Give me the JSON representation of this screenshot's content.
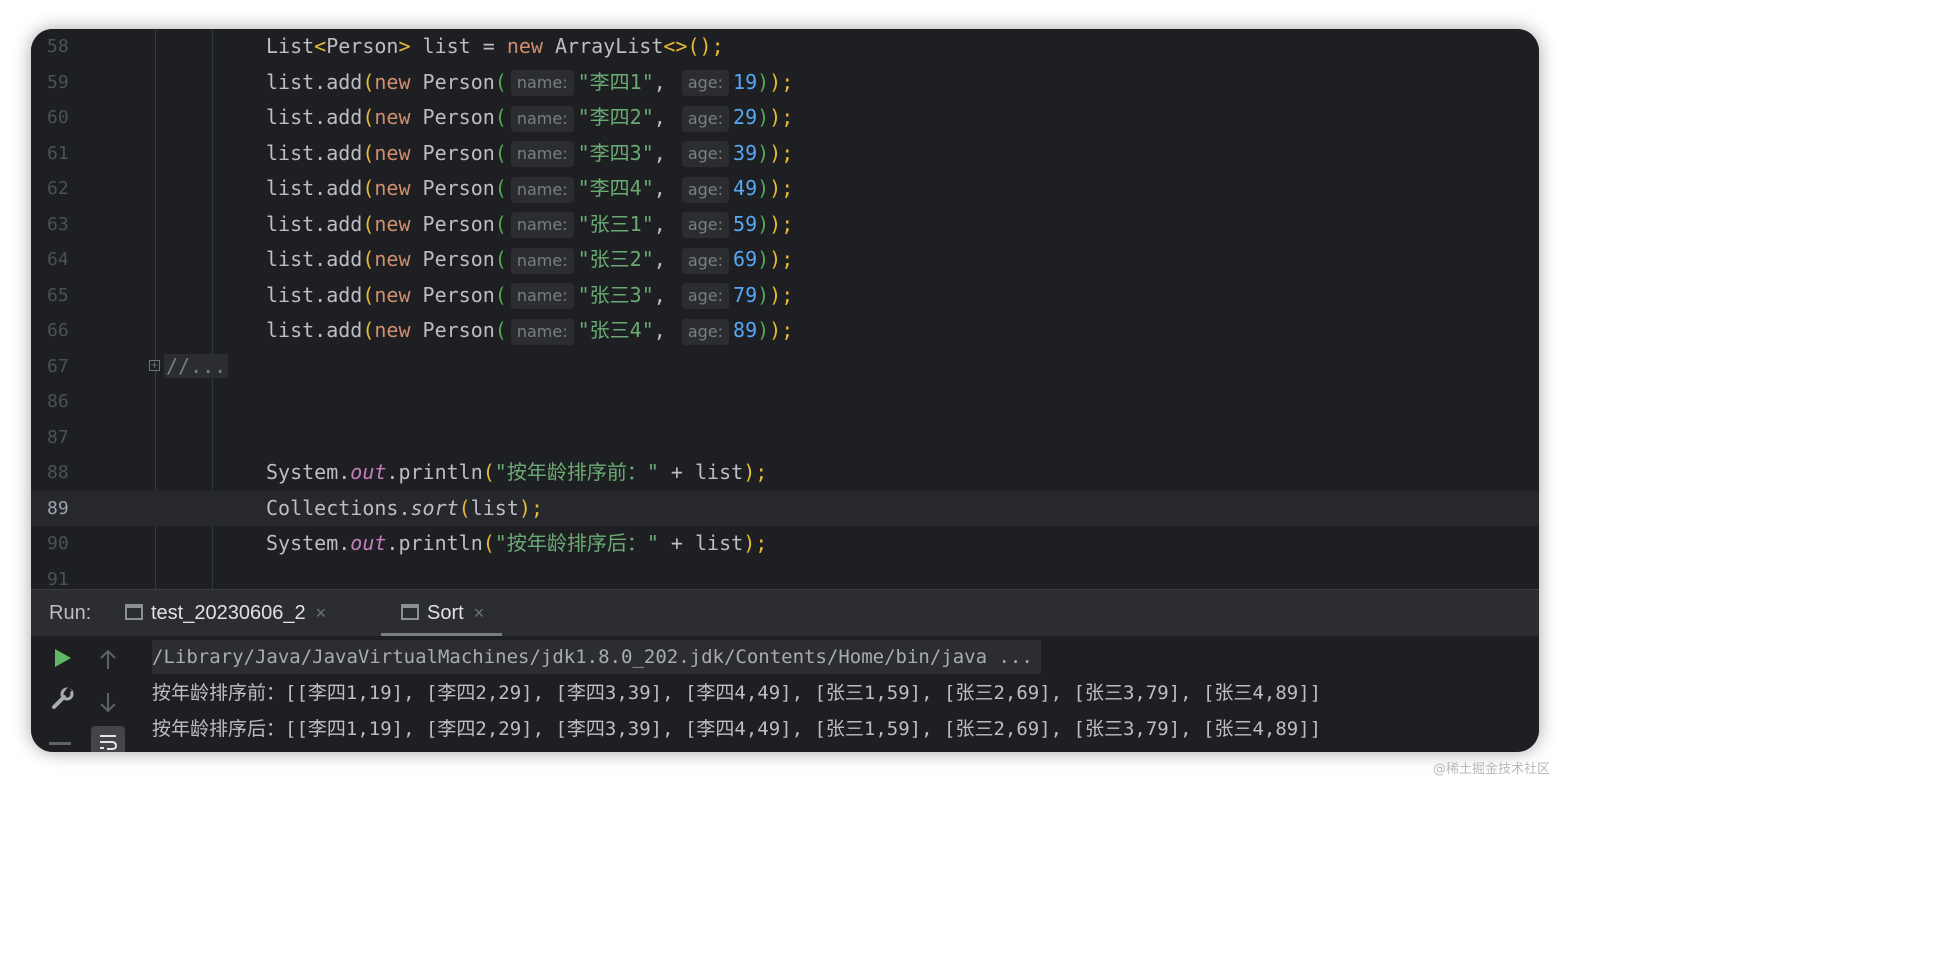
{
  "editor": {
    "lines": [
      {
        "n": "58",
        "segments": [
          [
            "List",
            "t"
          ],
          [
            "<",
            "p"
          ],
          [
            "Person",
            "t"
          ],
          [
            ">",
            "p"
          ],
          [
            " list = ",
            "t"
          ],
          [
            "new",
            "k"
          ],
          [
            " ArrayList",
            "t"
          ],
          [
            "<>",
            "p"
          ],
          [
            "()",
            "p"
          ],
          [
            ";",
            "p"
          ]
        ]
      },
      {
        "n": "59",
        "person": {
          "name": "\"李四1\"",
          "age": "19"
        }
      },
      {
        "n": "60",
        "person": {
          "name": "\"李四2\"",
          "age": "29"
        }
      },
      {
        "n": "61",
        "person": {
          "name": "\"李四3\"",
          "age": "39"
        }
      },
      {
        "n": "62",
        "person": {
          "name": "\"李四4\"",
          "age": "49"
        }
      },
      {
        "n": "63",
        "person": {
          "name": "\"张三1\"",
          "age": "59"
        }
      },
      {
        "n": "64",
        "person": {
          "name": "\"张三2\"",
          "age": "69"
        }
      },
      {
        "n": "65",
        "person": {
          "name": "\"张三3\"",
          "age": "79"
        }
      },
      {
        "n": "66",
        "person": {
          "name": "\"张三4\"",
          "age": "89"
        }
      },
      {
        "n": "67",
        "folded": "//..."
      },
      {
        "n": "86"
      },
      {
        "n": "87"
      },
      {
        "n": "88",
        "println": {
          "obj": "System",
          "field": "out",
          "method": ".println",
          "str": "\"按年龄排序前：\"",
          "rest": " + list"
        }
      },
      {
        "n": "89",
        "sort": {
          "cls": "Collections",
          "method": "sort",
          "arg": "list"
        },
        "current": true
      },
      {
        "n": "90",
        "println": {
          "obj": "System",
          "field": "out",
          "method": ".println",
          "str": "\"按年龄排序后：\"",
          "rest": " + list"
        }
      },
      {
        "n": "91"
      }
    ],
    "hint_name": "name:",
    "hint_age": "age:"
  },
  "run": {
    "label": "Run:",
    "tabs": [
      {
        "label": "test_20230606_2",
        "close": "×"
      },
      {
        "label": "Sort",
        "close": "×"
      }
    ]
  },
  "console": {
    "command": "/Library/Java/JavaVirtualMachines/jdk1.8.0_202.jdk/Contents/Home/bin/java ...",
    "output_before": "按年龄排序前：[[李四1,19], [李四2,29], [李四3,39], [李四4,49], [张三1,59], [张三2,69], [张三3,79], [张三4,89]]",
    "output_after": "按年龄排序后：[[李四1,19], [李四2,29], [李四3,39], [李四4,49], [张三1,59], [张三2,69], [张三3,79], [张三4,89]]"
  },
  "watermark": "@稀土掘金技术社区",
  "colors": {
    "background": "#1e1f22",
    "keyword": "#cf8e6d",
    "string": "#6aab73",
    "number": "#56a8f5",
    "paren": "#e8ba36"
  }
}
